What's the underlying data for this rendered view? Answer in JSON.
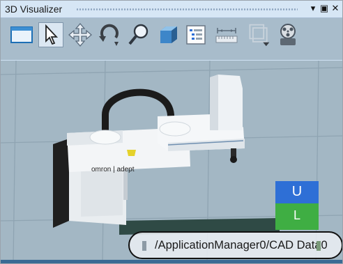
{
  "window": {
    "title": "3D Visualizer",
    "controls": {
      "dropdown": "▾",
      "maximize": "▣",
      "close": "✕"
    }
  },
  "toolbar": {
    "tools": [
      {
        "name": "view-window-icon"
      },
      {
        "name": "select-pointer-icon",
        "selected": true
      },
      {
        "name": "move-arrows-icon"
      },
      {
        "name": "rotate-icon"
      },
      {
        "name": "zoom-magnifier-icon"
      },
      {
        "name": "solid-box-icon"
      },
      {
        "name": "list-view-icon"
      },
      {
        "name": "measure-ruler-icon"
      },
      {
        "name": "bounding-box-icon"
      },
      {
        "name": "camera-reel-icon"
      }
    ]
  },
  "viewport": {
    "robot_brand": "omron | adept",
    "u_label": "U",
    "l_label": "L",
    "cad_label": "/ApplicationManager0/CAD Data0"
  },
  "colors": {
    "title_bar": "#d6e6f5",
    "toolbar": "#a8bccb",
    "viewport": "#a3b7c4",
    "u_block": "#2e6fd6",
    "l_block": "#3fae43"
  }
}
